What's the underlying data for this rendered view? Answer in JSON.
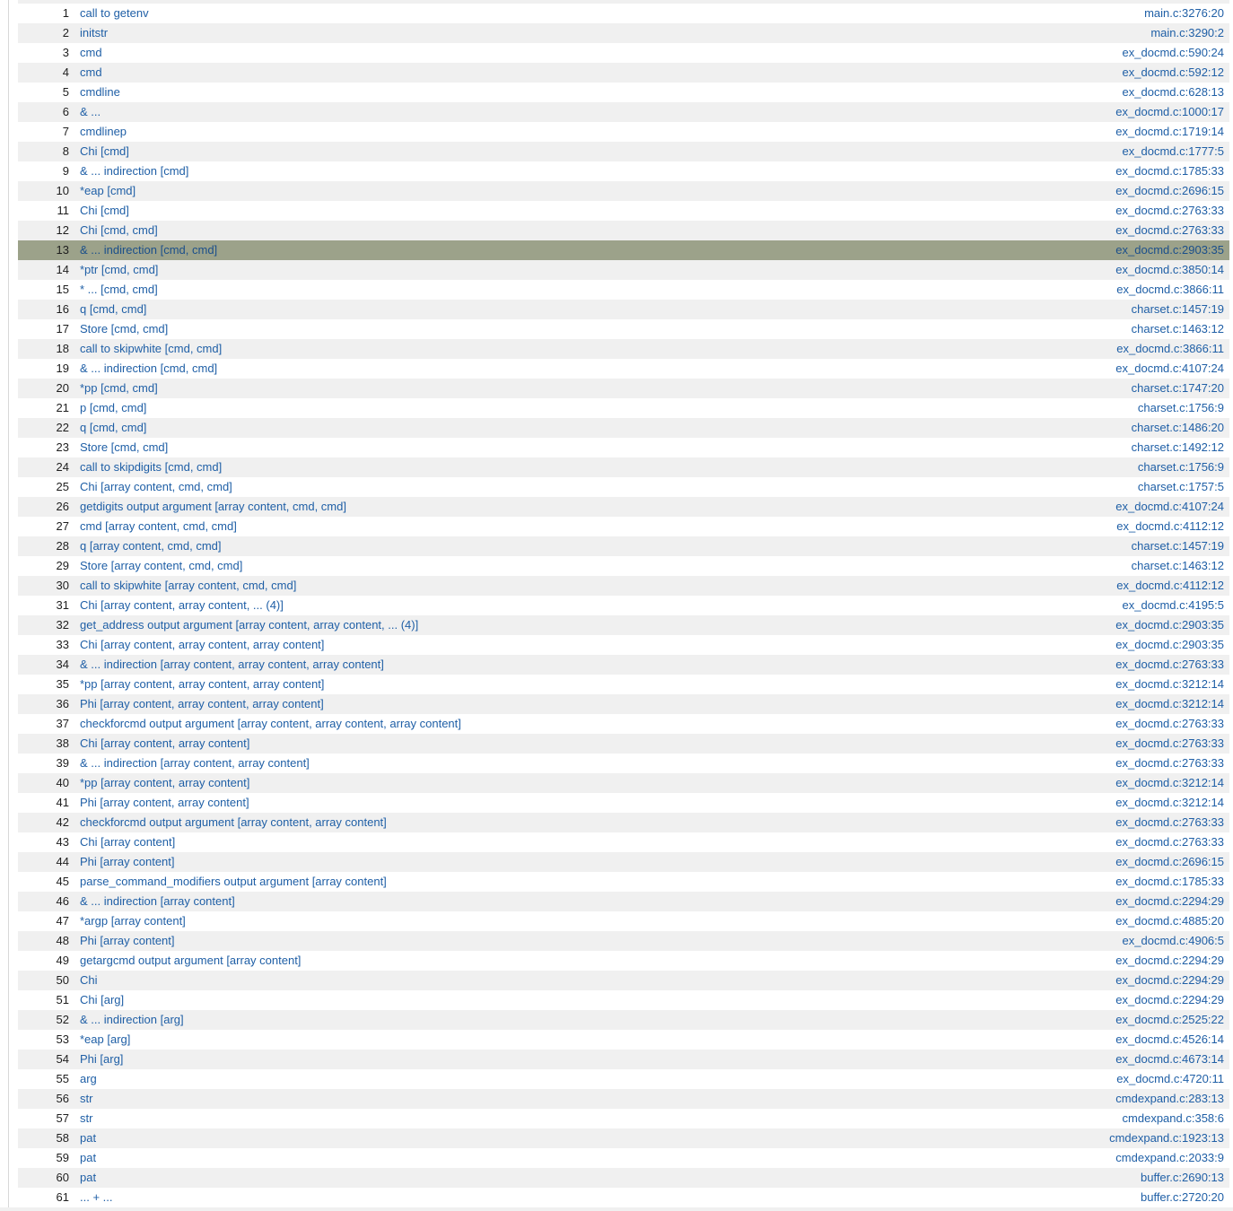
{
  "path": {
    "selected_index": 13,
    "rows": [
      {
        "index": "1",
        "step": "call to getenv",
        "location": "main.c:3276:20"
      },
      {
        "index": "2",
        "step": "initstr",
        "location": "main.c:3290:2"
      },
      {
        "index": "3",
        "step": "cmd",
        "location": "ex_docmd.c:590:24"
      },
      {
        "index": "4",
        "step": "cmd",
        "location": "ex_docmd.c:592:12"
      },
      {
        "index": "5",
        "step": "cmdline",
        "location": "ex_docmd.c:628:13"
      },
      {
        "index": "6",
        "step": "& ...",
        "location": "ex_docmd.c:1000:17"
      },
      {
        "index": "7",
        "step": "cmdlinep",
        "location": "ex_docmd.c:1719:14"
      },
      {
        "index": "8",
        "step": "Chi [cmd]",
        "location": "ex_docmd.c:1777:5"
      },
      {
        "index": "9",
        "step": "& ... indirection [cmd]",
        "location": "ex_docmd.c:1785:33"
      },
      {
        "index": "10",
        "step": "*eap [cmd]",
        "location": "ex_docmd.c:2696:15"
      },
      {
        "index": "11",
        "step": "Chi [cmd]",
        "location": "ex_docmd.c:2763:33"
      },
      {
        "index": "12",
        "step": "Chi [cmd, cmd]",
        "location": "ex_docmd.c:2763:33"
      },
      {
        "index": "13",
        "step": "& ... indirection [cmd, cmd]",
        "location": "ex_docmd.c:2903:35"
      },
      {
        "index": "14",
        "step": "*ptr [cmd, cmd]",
        "location": "ex_docmd.c:3850:14"
      },
      {
        "index": "15",
        "step": "* ... [cmd, cmd]",
        "location": "ex_docmd.c:3866:11"
      },
      {
        "index": "16",
        "step": "q [cmd, cmd]",
        "location": "charset.c:1457:19"
      },
      {
        "index": "17",
        "step": "Store [cmd, cmd]",
        "location": "charset.c:1463:12"
      },
      {
        "index": "18",
        "step": "call to skipwhite [cmd, cmd]",
        "location": "ex_docmd.c:3866:11"
      },
      {
        "index": "19",
        "step": "& ... indirection [cmd, cmd]",
        "location": "ex_docmd.c:4107:24"
      },
      {
        "index": "20",
        "step": "*pp [cmd, cmd]",
        "location": "charset.c:1747:20"
      },
      {
        "index": "21",
        "step": "p [cmd, cmd]",
        "location": "charset.c:1756:9"
      },
      {
        "index": "22",
        "step": "q [cmd, cmd]",
        "location": "charset.c:1486:20"
      },
      {
        "index": "23",
        "step": "Store [cmd, cmd]",
        "location": "charset.c:1492:12"
      },
      {
        "index": "24",
        "step": "call to skipdigits [cmd, cmd]",
        "location": "charset.c:1756:9"
      },
      {
        "index": "25",
        "step": "Chi [array content, cmd, cmd]",
        "location": "charset.c:1757:5"
      },
      {
        "index": "26",
        "step": "getdigits output argument [array content, cmd, cmd]",
        "location": "ex_docmd.c:4107:24"
      },
      {
        "index": "27",
        "step": "cmd [array content, cmd, cmd]",
        "location": "ex_docmd.c:4112:12"
      },
      {
        "index": "28",
        "step": "q [array content, cmd, cmd]",
        "location": "charset.c:1457:19"
      },
      {
        "index": "29",
        "step": "Store [array content, cmd, cmd]",
        "location": "charset.c:1463:12"
      },
      {
        "index": "30",
        "step": "call to skipwhite [array content, cmd, cmd]",
        "location": "ex_docmd.c:4112:12"
      },
      {
        "index": "31",
        "step": "Chi [array content, array content, ... (4)]",
        "location": "ex_docmd.c:4195:5"
      },
      {
        "index": "32",
        "step": "get_address output argument [array content, array content, ... (4)]",
        "location": "ex_docmd.c:2903:35"
      },
      {
        "index": "33",
        "step": "Chi [array content, array content, array content]",
        "location": "ex_docmd.c:2903:35"
      },
      {
        "index": "34",
        "step": "& ... indirection [array content, array content, array content]",
        "location": "ex_docmd.c:2763:33"
      },
      {
        "index": "35",
        "step": "*pp [array content, array content, array content]",
        "location": "ex_docmd.c:3212:14"
      },
      {
        "index": "36",
        "step": "Phi [array content, array content, array content]",
        "location": "ex_docmd.c:3212:14"
      },
      {
        "index": "37",
        "step": "checkforcmd output argument [array content, array content, array content]",
        "location": "ex_docmd.c:2763:33"
      },
      {
        "index": "38",
        "step": "Chi [array content, array content]",
        "location": "ex_docmd.c:2763:33"
      },
      {
        "index": "39",
        "step": "& ... indirection [array content, array content]",
        "location": "ex_docmd.c:2763:33"
      },
      {
        "index": "40",
        "step": "*pp [array content, array content]",
        "location": "ex_docmd.c:3212:14"
      },
      {
        "index": "41",
        "step": "Phi [array content, array content]",
        "location": "ex_docmd.c:3212:14"
      },
      {
        "index": "42",
        "step": "checkforcmd output argument [array content, array content]",
        "location": "ex_docmd.c:2763:33"
      },
      {
        "index": "43",
        "step": "Chi [array content]",
        "location": "ex_docmd.c:2763:33"
      },
      {
        "index": "44",
        "step": "Phi [array content]",
        "location": "ex_docmd.c:2696:15"
      },
      {
        "index": "45",
        "step": "parse_command_modifiers output argument [array content]",
        "location": "ex_docmd.c:1785:33"
      },
      {
        "index": "46",
        "step": "& ... indirection [array content]",
        "location": "ex_docmd.c:2294:29"
      },
      {
        "index": "47",
        "step": "*argp [array content]",
        "location": "ex_docmd.c:4885:20"
      },
      {
        "index": "48",
        "step": "Phi [array content]",
        "location": "ex_docmd.c:4906:5"
      },
      {
        "index": "49",
        "step": "getargcmd output argument [array content]",
        "location": "ex_docmd.c:2294:29"
      },
      {
        "index": "50",
        "step": "Chi",
        "location": "ex_docmd.c:2294:29"
      },
      {
        "index": "51",
        "step": "Chi [arg]",
        "location": "ex_docmd.c:2294:29"
      },
      {
        "index": "52",
        "step": "& ... indirection [arg]",
        "location": "ex_docmd.c:2525:22"
      },
      {
        "index": "53",
        "step": "*eap [arg]",
        "location": "ex_docmd.c:4526:14"
      },
      {
        "index": "54",
        "step": "Phi [arg]",
        "location": "ex_docmd.c:4673:14"
      },
      {
        "index": "55",
        "step": "arg",
        "location": "ex_docmd.c:4720:11"
      },
      {
        "index": "56",
        "step": "str",
        "location": "cmdexpand.c:283:13"
      },
      {
        "index": "57",
        "step": "str",
        "location": "cmdexpand.c:358:6"
      },
      {
        "index": "58",
        "step": "pat",
        "location": "cmdexpand.c:1923:13"
      },
      {
        "index": "59",
        "step": "pat",
        "location": "cmdexpand.c:2033:9"
      },
      {
        "index": "60",
        "step": "pat",
        "location": "buffer.c:2690:13"
      },
      {
        "index": "61",
        "step": "... + ...",
        "location": "buffer.c:2720:20"
      }
    ]
  }
}
